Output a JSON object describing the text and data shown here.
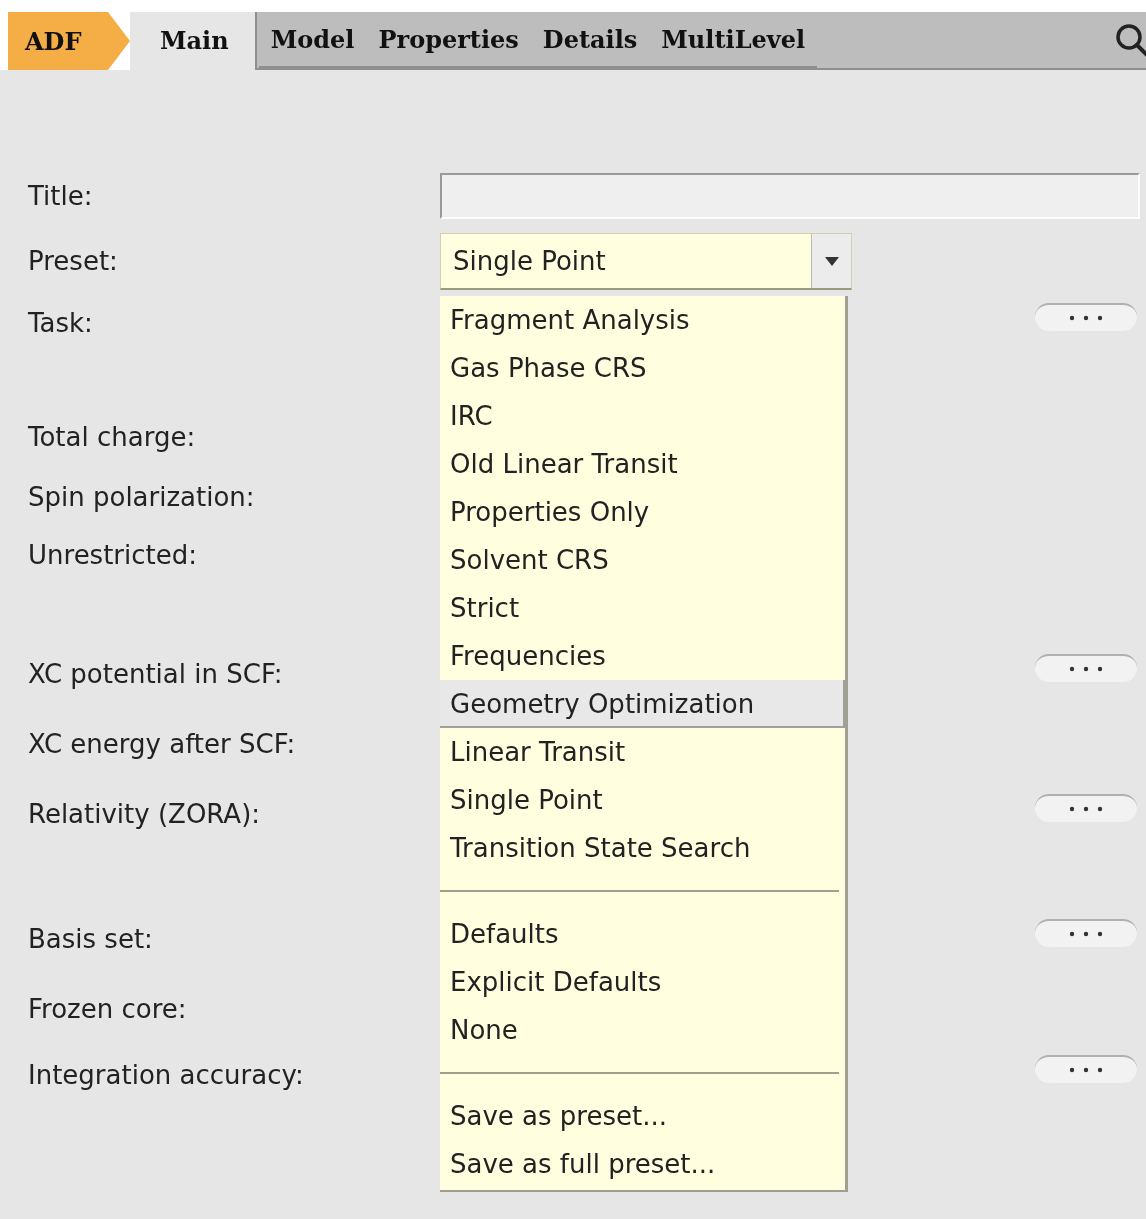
{
  "module": "ADF",
  "tabs": [
    {
      "label": "Main",
      "selected": true
    },
    {
      "label": "Model",
      "selected": false
    },
    {
      "label": "Properties",
      "selected": false
    },
    {
      "label": "Details",
      "selected": false
    },
    {
      "label": "MultiLevel",
      "selected": false
    }
  ],
  "form": {
    "rows": [
      {
        "label": "Title:",
        "kind": "text"
      },
      {
        "label": "Preset:",
        "kind": "combo",
        "value": "Single Point"
      },
      {
        "label": "Task:",
        "kind": "more"
      },
      {
        "label": "Total charge:",
        "kind": "plain"
      },
      {
        "label": "Spin polarization:",
        "kind": "plain"
      },
      {
        "label": "Unrestricted:",
        "kind": "plain"
      },
      {
        "label": "XC potential in SCF:",
        "kind": "more"
      },
      {
        "label": "XC energy after SCF:",
        "kind": "plain"
      },
      {
        "label": "Relativity (ZORA):",
        "kind": "more"
      },
      {
        "label": "Basis set:",
        "kind": "more"
      },
      {
        "label": "Frozen core:",
        "kind": "plain"
      },
      {
        "label": "Integration accuracy:",
        "kind": "more"
      }
    ]
  },
  "preset_menu": {
    "groups": [
      [
        {
          "label": "Fragment Analysis",
          "selected": false
        },
        {
          "label": "Gas Phase CRS",
          "selected": false
        },
        {
          "label": "IRC",
          "selected": false
        },
        {
          "label": "Old Linear Transit",
          "selected": false
        },
        {
          "label": "Properties Only",
          "selected": false
        },
        {
          "label": "Solvent CRS",
          "selected": false
        },
        {
          "label": "Strict",
          "selected": false
        },
        {
          "label": "Frequencies",
          "selected": false
        },
        {
          "label": "Geometry Optimization",
          "selected": true
        },
        {
          "label": "Linear Transit",
          "selected": false
        },
        {
          "label": "Single Point",
          "selected": false
        },
        {
          "label": "Transition State Search",
          "selected": false
        }
      ],
      [
        {
          "label": "Defaults",
          "selected": false
        },
        {
          "label": "Explicit Defaults",
          "selected": false
        },
        {
          "label": "None",
          "selected": false
        }
      ],
      [
        {
          "label": "Save as preset...",
          "selected": false
        },
        {
          "label": "Save as full preset...",
          "selected": false
        }
      ]
    ]
  }
}
